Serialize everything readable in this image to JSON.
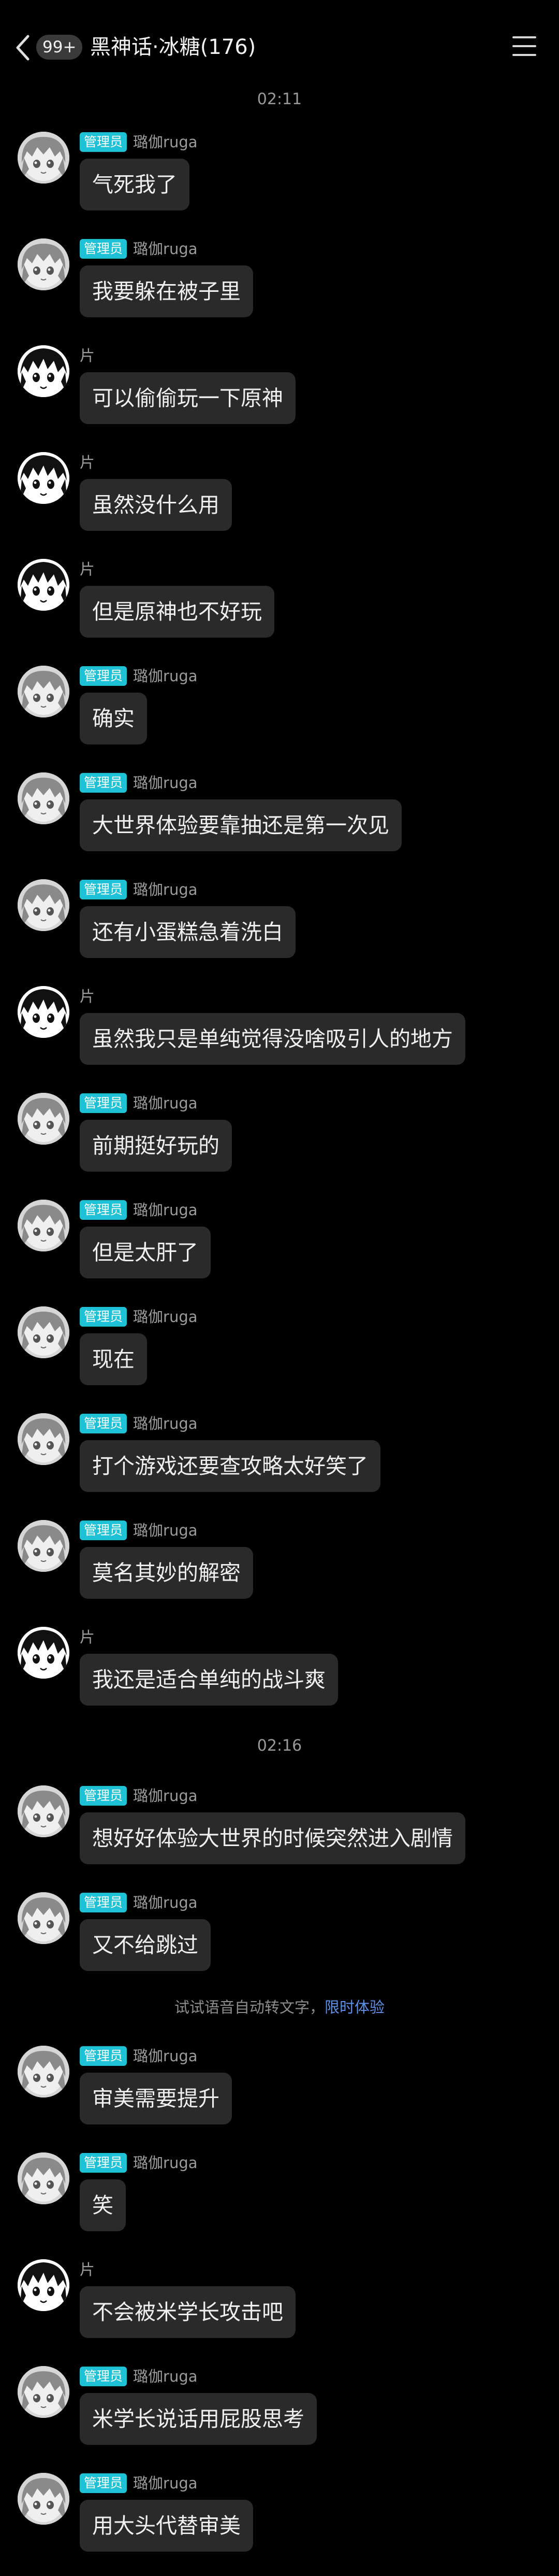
{
  "header": {
    "unread_badge": "99+",
    "title": "黑神话·冰糖(176)"
  },
  "timestamps": [
    "02:11",
    "02:16"
  ],
  "hint": {
    "text": "试试语音自动转文字，",
    "link": "限时体验"
  },
  "role_badge": "管理员",
  "colors": {
    "role_badge": "#1ec1d6",
    "link": "#5b8fe8",
    "bubble": "#2a2a2a",
    "background": "#000000"
  },
  "messages": [
    {
      "sender": "璐伽ruga",
      "admin": true,
      "avatar": "ruga-avatar",
      "text": "气死我了"
    },
    {
      "sender": "璐伽ruga",
      "admin": true,
      "avatar": "ruga-avatar",
      "text": "我要躲在被子里"
    },
    {
      "sender": "片",
      "admin": false,
      "avatar": "pian-avatar",
      "text": "可以偷偷玩一下原神"
    },
    {
      "sender": "片",
      "admin": false,
      "avatar": "pian-avatar",
      "text": "虽然没什么用"
    },
    {
      "sender": "片",
      "admin": false,
      "avatar": "pian-avatar",
      "text": "但是原神也不好玩"
    },
    {
      "sender": "璐伽ruga",
      "admin": true,
      "avatar": "ruga-avatar",
      "text": "确实"
    },
    {
      "sender": "璐伽ruga",
      "admin": true,
      "avatar": "ruga-avatar",
      "text": "大世界体验要靠抽还是第一次见"
    },
    {
      "sender": "璐伽ruga",
      "admin": true,
      "avatar": "ruga-avatar",
      "text": "还有小蛋糕急着洗白"
    },
    {
      "sender": "片",
      "admin": false,
      "avatar": "pian-avatar",
      "text": "虽然我只是单纯觉得没啥吸引人的地方"
    },
    {
      "sender": "璐伽ruga",
      "admin": true,
      "avatar": "ruga-avatar",
      "text": "前期挺好玩的"
    },
    {
      "sender": "璐伽ruga",
      "admin": true,
      "avatar": "ruga-avatar",
      "text": "但是太肝了"
    },
    {
      "sender": "璐伽ruga",
      "admin": true,
      "avatar": "ruga-avatar",
      "text": "现在"
    },
    {
      "sender": "璐伽ruga",
      "admin": true,
      "avatar": "ruga-avatar",
      "text": "打个游戏还要查攻略太好笑了"
    },
    {
      "sender": "璐伽ruga",
      "admin": true,
      "avatar": "ruga-avatar",
      "text": "莫名其妙的解密"
    },
    {
      "sender": "片",
      "admin": false,
      "avatar": "pian-avatar",
      "text": "我还是适合单纯的战斗爽"
    },
    {
      "sender": "璐伽ruga",
      "admin": true,
      "avatar": "ruga-avatar",
      "text": "想好好体验大世界的时候突然进入剧情"
    },
    {
      "sender": "璐伽ruga",
      "admin": true,
      "avatar": "ruga-avatar",
      "text": "又不给跳过"
    },
    {
      "sender": "璐伽ruga",
      "admin": true,
      "avatar": "ruga-avatar",
      "text": "审美需要提升"
    },
    {
      "sender": "璐伽ruga",
      "admin": true,
      "avatar": "ruga-avatar",
      "text": "笑"
    },
    {
      "sender": "片",
      "admin": false,
      "avatar": "pian-avatar",
      "text": "不会被米学长攻击吧"
    },
    {
      "sender": "璐伽ruga",
      "admin": true,
      "avatar": "ruga-avatar",
      "text": "米学长说话用屁股思考"
    },
    {
      "sender": "璐伽ruga",
      "admin": true,
      "avatar": "ruga-avatar",
      "text": "用大头代替审美"
    }
  ]
}
